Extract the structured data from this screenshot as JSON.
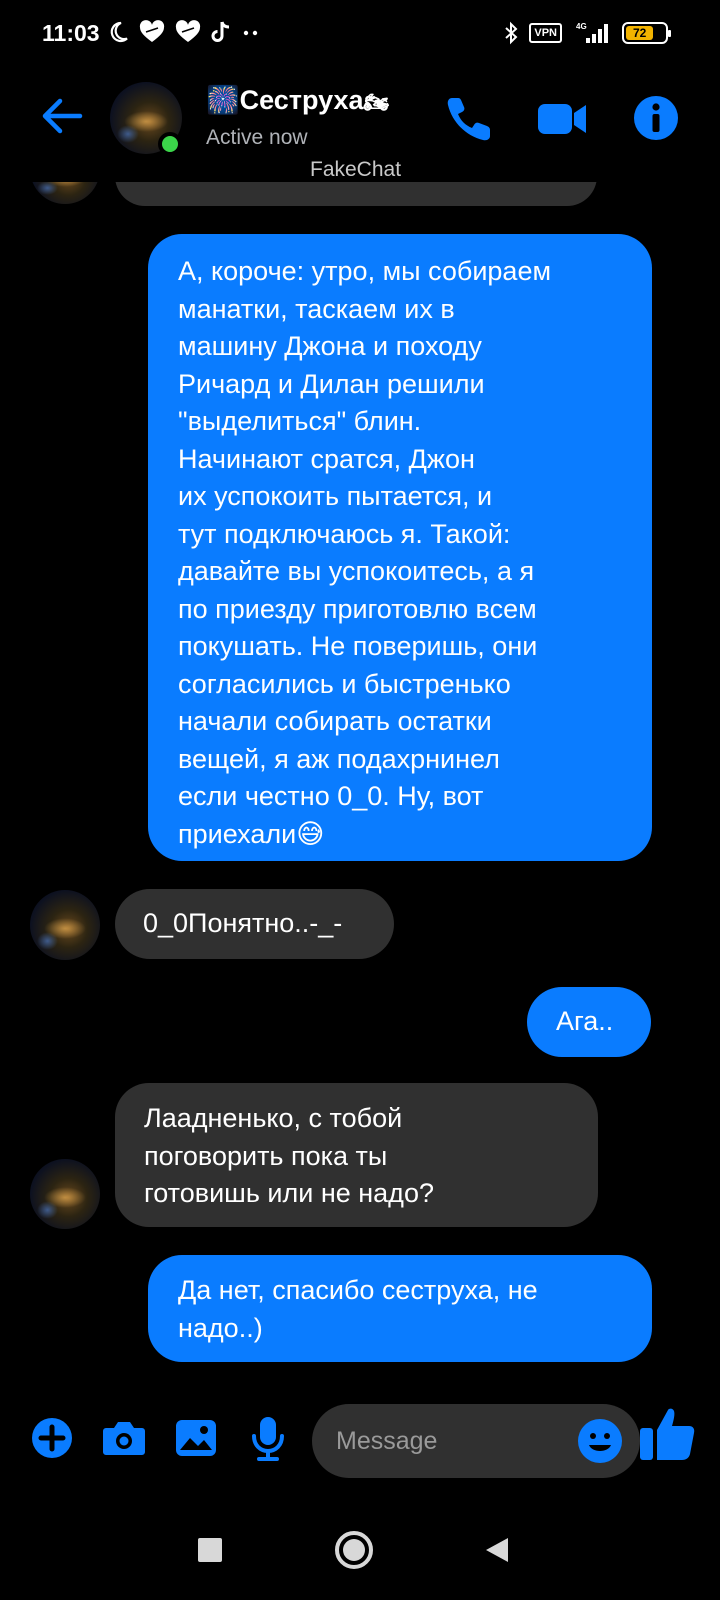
{
  "status_bar": {
    "time": "11:03",
    "vpn": "VPN",
    "network": "4G",
    "battery": "72",
    "battery_level": 0.72
  },
  "header": {
    "name_prefix_emoji": "🎆",
    "name": "Сеструха",
    "name_suffix_emoji": "🏍",
    "status": "Active now",
    "watermark": "FakeChat",
    "accent": "#0a7cff",
    "online_color": "#3bd54a"
  },
  "messages": [
    {
      "direction": "outgoing",
      "text": "А, короче: утро, мы собираем\nманатки, таскаем их в\nмашину Джона и походу\nРичард и Дилан решили\n\"выделиться\" блин.\nНачинают сратся, Джон\nих успокоить пытается, и\nтут подключаюсь я. Такой:\nдавайте вы успокоитесь, а я\nпо приезду приготовлю всем\nпокушать. Не поверишь, они\nсогласились и быстренько\nначали собирать остатки\nвещей, я аж подахрнинел\nесли честно 0_0. Ну, вот\nприехали😅"
    },
    {
      "direction": "incoming",
      "text": "0_0Понятно..-_-"
    },
    {
      "direction": "outgoing",
      "text": "Ага.."
    },
    {
      "direction": "incoming",
      "text": "Лаадненько, с тобой\nпоговорить пока ты\nготовишь или не надо?"
    },
    {
      "direction": "outgoing",
      "text": "Да нет, спасибо сеструха, не\nнадо..)"
    }
  ],
  "composer": {
    "placeholder": "Message",
    "icons": [
      "plus-icon",
      "camera-icon",
      "gallery-icon",
      "microphone-icon",
      "emoji-icon",
      "thumbs-up-icon"
    ]
  },
  "colors": {
    "outgoing_bubble": "#0a7cff",
    "incoming_bubble": "#303030",
    "background": "#000000"
  }
}
